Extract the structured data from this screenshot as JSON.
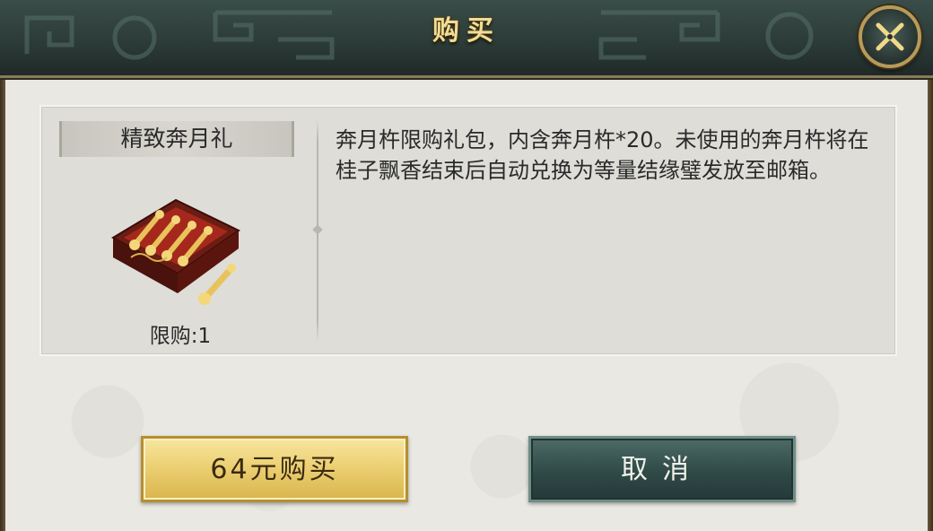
{
  "dialog": {
    "title": "购买",
    "close_icon": "close-x-icon"
  },
  "item": {
    "name": "精致奔月礼",
    "image_icon": "gift-box-icon",
    "limit": "限购:1",
    "description": "奔月杵限购礼包，内含奔月杵*20。未使用的奔月杵将在桂子飘香结束后自动兑换为等量结缘璧发放至邮箱。"
  },
  "buttons": {
    "buy": "64元购买",
    "cancel": "取消"
  },
  "colors": {
    "title_bar": "#2b3a37",
    "title_text": "#f2dc94",
    "buy_button": "#ecd074",
    "cancel_button": "#2f4a47",
    "panel_bg": "#deddd8"
  }
}
